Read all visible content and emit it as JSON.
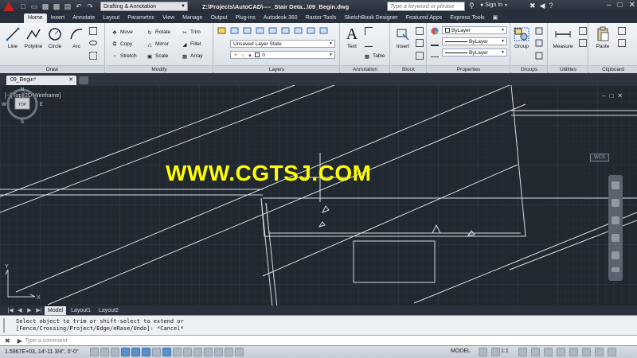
{
  "titlebar": {
    "workspace": "Drafting & Annotation",
    "doc_title": "Z:\\Projects\\AutoCAD\\----_Stair Deta...\\09_Begin.dwg",
    "search_placeholder": "Type a keyword or phrase",
    "signin": "Sign In"
  },
  "ribbon_tabs": [
    "Home",
    "Insert",
    "Annotate",
    "Layout",
    "Parametric",
    "View",
    "Manage",
    "Output",
    "Plug-ins",
    "Autodesk 360",
    "Raster Tools",
    "SketchBook Designer",
    "Featured Apps",
    "Express Tools"
  ],
  "panels": {
    "draw": {
      "title": "Draw",
      "line": "Line",
      "polyline": "Polyline",
      "circle": "Circle",
      "arc": "Arc"
    },
    "modify": {
      "title": "Modify",
      "move": "Move",
      "rotate": "Rotate",
      "trim": "Trim",
      "copy": "Copy",
      "mirror": "Mirror",
      "fillet": "Fillet",
      "stretch": "Stretch",
      "scale": "Scale",
      "array": "Array"
    },
    "layers": {
      "title": "Layers",
      "layer_state": "Unsaved Layer State",
      "current_layer": "0"
    },
    "annotation": {
      "title": "Annotation",
      "text": "Text",
      "table": "Table"
    },
    "block": {
      "title": "Block",
      "insert": "Insert"
    },
    "properties": {
      "title": "Properties",
      "color": "ByLayer",
      "linetype": "ByLayer",
      "lineweight": "ByLayer"
    },
    "groups": {
      "title": "Groups",
      "group": "Group"
    },
    "utilities": {
      "title": "Utilities",
      "measure": "Measure"
    },
    "clipboard": {
      "title": "Clipboard",
      "paste": "Paste"
    }
  },
  "document_tab": "09_Begin*",
  "viewport": {
    "label": "[−][Top][2D Wireframe]",
    "watermark": "WWW.CGTSJ.COM",
    "viewcube": {
      "top": "TOP",
      "n": "N",
      "s": "S",
      "e": "E",
      "w": "W"
    },
    "wcs": "WCS"
  },
  "layout_tabs": [
    "Model",
    "Layout1",
    "Layout2"
  ],
  "command": {
    "line1": "Select object to trim or shift-select to extend or",
    "line2": "[Fence/Crossing/Project/Edge/eRase/Undo]: *Cancel*",
    "placeholder": "Type a command"
  },
  "status": {
    "coords": "1.5967E+03,  14'-11 3/4\",  0'-0\"",
    "model": "MODEL",
    "scale": "1:1"
  },
  "colors": {
    "drawing_bg": "#212830",
    "grid": "#2c3540",
    "geometry": "#d8dde2",
    "watermark": "#ffff00",
    "ribbon": "#e4e8ee"
  },
  "icons": [
    "app-logo-icon",
    "new-icon",
    "open-icon",
    "save-icon",
    "print-icon",
    "undo-icon",
    "redo-icon",
    "search-icon",
    "user-icon",
    "help-icon"
  ]
}
